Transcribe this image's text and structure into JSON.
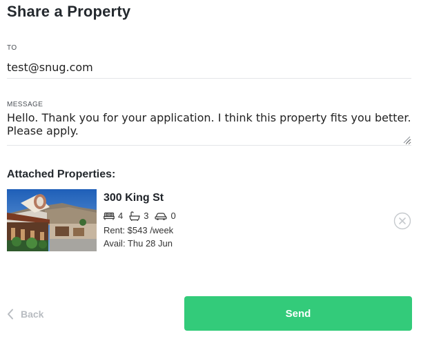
{
  "header": {
    "title": "Share a Property"
  },
  "form": {
    "to_label": "TO",
    "to_value": "test@snug.com",
    "message_label": "MESSAGE",
    "message_value": "Hello. Thank you for your application. I think this property fits you better. Please apply."
  },
  "attached": {
    "heading": "Attached Properties:",
    "properties": [
      {
        "address": "300 King St",
        "bedrooms": "4",
        "bathrooms": "3",
        "parking": "0",
        "rent": "Rent: $543 /week",
        "available": "Avail: Thu 28 Jun",
        "icons": {
          "bedrooms": "bed-icon",
          "bathrooms": "bath-icon",
          "parking": "car-icon",
          "remove": "close-circle-icon"
        }
      }
    ]
  },
  "footer": {
    "back_label": "Back",
    "send_label": "Send"
  },
  "colors": {
    "accent": "#33cb7a",
    "muted": "#b8bcc1",
    "divider": "#e3e5e8"
  }
}
